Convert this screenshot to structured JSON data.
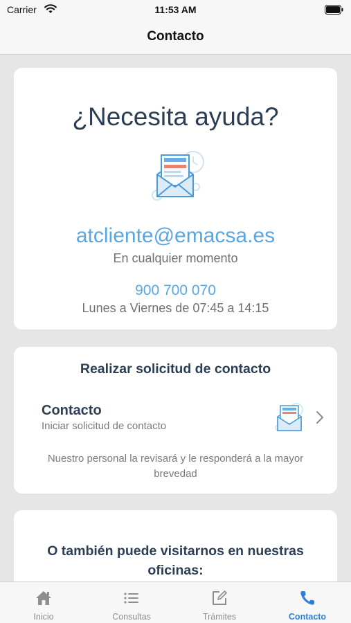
{
  "status_bar": {
    "carrier": "Carrier",
    "time": "11:53 AM"
  },
  "nav": {
    "title": "Contacto"
  },
  "help_card": {
    "heading": "¿Necesita ayuda?",
    "email": "atcliente@emacsa.es",
    "email_note": "En cualquier momento",
    "phone": "900 700 070",
    "phone_note": "Lunes a Viernes de 07:45 a 14:15",
    "illustration_icon": "envelope-letter-icon"
  },
  "request_card": {
    "title": "Realizar solicitud de contacto",
    "row": {
      "title": "Contacto",
      "subtitle": "Iniciar solicitud de contacto",
      "icon": "envelope-letter-icon",
      "chevron_icon": "chevron-right-icon"
    },
    "note": "Nuestro personal la revisará y le responderá a la mayor brevedad"
  },
  "visit_card": {
    "title": "O también puede visitarnos en nuestras oficinas:"
  },
  "tab_bar": {
    "tabs": [
      {
        "label": "Inicio",
        "icon": "home-icon",
        "active": false
      },
      {
        "label": "Consultas",
        "icon": "list-icon",
        "active": false
      },
      {
        "label": "Trámites",
        "icon": "edit-icon",
        "active": false
      },
      {
        "label": "Contacto",
        "icon": "phone-icon",
        "active": true
      }
    ]
  },
  "colors": {
    "accent_text": "#5aa6e0",
    "heading_text": "#2c3e55",
    "active_tab": "#2f7fd6",
    "background": "#e6e6e6"
  }
}
